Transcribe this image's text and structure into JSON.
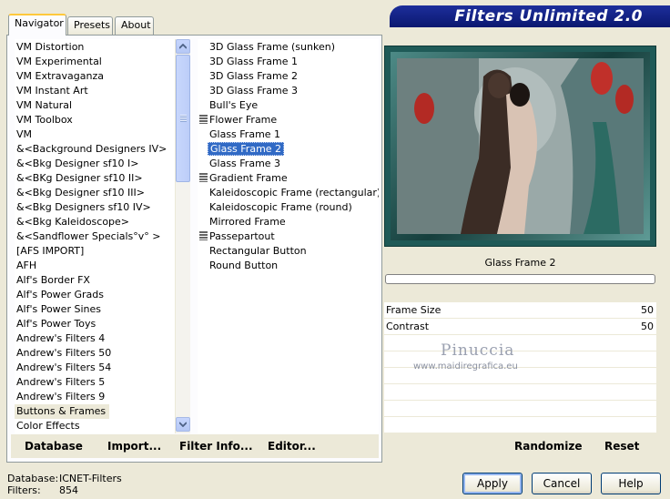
{
  "tabs": [
    {
      "label": "Navigator"
    },
    {
      "label": "Presets"
    },
    {
      "label": "About"
    }
  ],
  "banner": {
    "title": "Filters Unlimited 2.0"
  },
  "categories": [
    {
      "label": "VM Distortion"
    },
    {
      "label": "VM Experimental"
    },
    {
      "label": "VM Extravaganza"
    },
    {
      "label": "VM Instant Art"
    },
    {
      "label": "VM Natural"
    },
    {
      "label": "VM Toolbox"
    },
    {
      "label": "VM"
    },
    {
      "label": "&<Background Designers IV>"
    },
    {
      "label": "&<Bkg Designer sf10 I>"
    },
    {
      "label": "&<BKg Designer sf10 II>"
    },
    {
      "label": "&<Bkg Designer sf10 III>"
    },
    {
      "label": "&<Bkg Designers sf10 IV>"
    },
    {
      "label": "&<Bkg Kaleidoscope>"
    },
    {
      "label": "&<Sandflower Specials°v° >"
    },
    {
      "label": "[AFS IMPORT]"
    },
    {
      "label": "AFH"
    },
    {
      "label": "Alf's Border FX"
    },
    {
      "label": "Alf's Power Grads"
    },
    {
      "label": "Alf's Power Sines"
    },
    {
      "label": "Alf's Power Toys"
    },
    {
      "label": "Andrew's Filters 4"
    },
    {
      "label": "Andrew's Filters 50"
    },
    {
      "label": "Andrew's Filters 54"
    },
    {
      "label": "Andrew's Filters 5"
    },
    {
      "label": "Andrew's Filters 9"
    },
    {
      "label": "Buttons & Frames"
    },
    {
      "label": "Color Effects"
    }
  ],
  "filters": [
    {
      "label": "3D Glass Frame (sunken)",
      "marker": false
    },
    {
      "label": "3D Glass Frame 1",
      "marker": false
    },
    {
      "label": "3D Glass Frame 2",
      "marker": false
    },
    {
      "label": "3D Glass Frame 3",
      "marker": false
    },
    {
      "label": "Bull's Eye",
      "marker": false
    },
    {
      "label": "Flower Frame",
      "marker": true
    },
    {
      "label": "Glass Frame 1",
      "marker": false
    },
    {
      "label": "Glass Frame 2",
      "marker": false
    },
    {
      "label": "Glass Frame 3",
      "marker": false
    },
    {
      "label": "Gradient Frame",
      "marker": true
    },
    {
      "label": "Kaleidoscopic Frame (rectangular)",
      "marker": false
    },
    {
      "label": "Kaleidoscopic Frame (round)",
      "marker": false
    },
    {
      "label": "Mirrored Frame",
      "marker": false
    },
    {
      "label": "Passepartout",
      "marker": true
    },
    {
      "label": "Rectangular Button",
      "marker": false
    },
    {
      "label": "Round Button",
      "marker": false
    }
  ],
  "commands": {
    "database": "Database",
    "import": "Import...",
    "filter_info": "Filter Info...",
    "editor": "Editor..."
  },
  "preview": {
    "filter_name": "Glass Frame 2"
  },
  "params": [
    {
      "label": "Frame Size",
      "value": "50"
    },
    {
      "label": "Contrast",
      "value": "50"
    }
  ],
  "watermark": {
    "line1": "Pinuccia",
    "line2": "www.maidiregrafica.eu"
  },
  "right_buttons": {
    "randomize": "Randomize",
    "reset": "Reset"
  },
  "status": {
    "db_label": "Database:",
    "db_value": "ICNET-Filters",
    "filters_label": "Filters:",
    "filters_value": "854"
  },
  "buttons": {
    "apply": "Apply",
    "cancel": "Cancel",
    "help": "Help"
  },
  "colors": {
    "selection": "#316ac5",
    "banner": "#0b1870",
    "panel": "#ece9d8"
  }
}
